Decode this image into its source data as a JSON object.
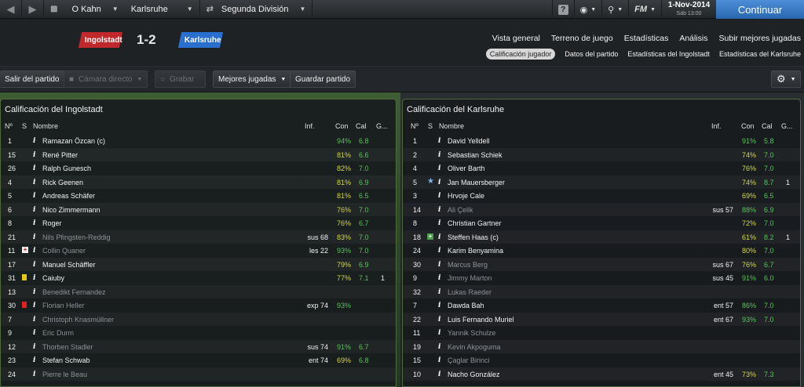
{
  "topbar": {
    "manager": "O Kahn",
    "club": "Karlsruhe",
    "competition": "Segunda División",
    "date": "1-Nov-2014",
    "time": "Sáb 13:00",
    "fm_label": "FM",
    "help_label": "?",
    "continue_label": "Continuar"
  },
  "match": {
    "home_team": "Ingolstadt",
    "away_team": "Karlsruhe",
    "score": "1-2",
    "home_color": "#c1282b",
    "away_color": "#2a6fd0"
  },
  "tabs_main": [
    "Vista general",
    "Terreno de juego",
    "Estadísticas",
    "Análisis",
    "Subir mejores jugadas"
  ],
  "tabs_sub": [
    {
      "label": "Calificación jugador",
      "active": true
    },
    {
      "label": "Datos del partido",
      "active": false
    },
    {
      "label": "Estadísticas del Ingolstadt",
      "active": false
    },
    {
      "label": "Estadísticas del Karlsruhe",
      "active": false
    }
  ],
  "toolbar": {
    "exit_label": "Salir del partido",
    "camera_label": "Cámara directo",
    "record_label": "Grabar",
    "highlights_label": "Mejores jugadas",
    "save_label": "Guardar partido"
  },
  "columns": {
    "num": "Nº",
    "status": "S",
    "name": "Nombre",
    "inf": "Inf.",
    "con": "Con",
    "cal": "Cal",
    "g": "G..."
  },
  "home_panel": {
    "title": "Calificación del Ingolstadt",
    "players": [
      {
        "num": "1",
        "status": "",
        "name": "Ramazan Özcan (c)",
        "inf": "",
        "con": "94%",
        "cal": "6.8",
        "g": "",
        "sub": false
      },
      {
        "num": "15",
        "status": "",
        "name": "René Pitter",
        "inf": "",
        "con": "81%",
        "cal": "6.6",
        "g": "",
        "sub": false
      },
      {
        "num": "26",
        "status": "",
        "name": "Ralph Gunesch",
        "inf": "",
        "con": "82%",
        "cal": "7.0",
        "g": "",
        "sub": false
      },
      {
        "num": "4",
        "status": "",
        "name": "Rick Geenen",
        "inf": "",
        "con": "81%",
        "cal": "6.9",
        "g": "",
        "sub": false
      },
      {
        "num": "5",
        "status": "",
        "name": "Andreas Schäfer",
        "inf": "",
        "con": "81%",
        "cal": "6.5",
        "g": "",
        "sub": false
      },
      {
        "num": "6",
        "status": "",
        "name": "Nico Zimmermann",
        "inf": "",
        "con": "76%",
        "cal": "7.0",
        "g": "",
        "sub": false
      },
      {
        "num": "8",
        "status": "",
        "name": "Roger",
        "inf": "",
        "con": "76%",
        "cal": "6.7",
        "g": "",
        "sub": false
      },
      {
        "num": "21",
        "status": "",
        "name": "Nils Pfingsten-Reddig",
        "inf": "sus 68",
        "con": "83%",
        "cal": "7.0",
        "g": "",
        "sub": true
      },
      {
        "num": "11",
        "status": "injury",
        "name": "Collin Quaner",
        "inf": "les 22",
        "con": "93%",
        "cal": "7.0",
        "g": "",
        "sub": true
      },
      {
        "num": "17",
        "status": "",
        "name": "Manuel Schäffler",
        "inf": "",
        "con": "79%",
        "cal": "6.9",
        "g": "",
        "sub": false
      },
      {
        "num": "31",
        "status": "yellow",
        "name": "Caiuby",
        "inf": "",
        "con": "77%",
        "cal": "7.1",
        "g": "1",
        "sub": false
      },
      {
        "num": "13",
        "status": "",
        "name": "Benedikt Fernandez",
        "inf": "",
        "con": "",
        "cal": "",
        "g": "",
        "sub": true
      },
      {
        "num": "30",
        "status": "red",
        "name": "Florian Heller",
        "inf": "exp 74",
        "con": "93%",
        "cal": "",
        "g": "",
        "sub": true
      },
      {
        "num": "7",
        "status": "",
        "name": "Christoph Knasmüllner",
        "inf": "",
        "con": "",
        "cal": "",
        "g": "",
        "sub": true
      },
      {
        "num": "9",
        "status": "",
        "name": "Eric Durm",
        "inf": "",
        "con": "",
        "cal": "",
        "g": "",
        "sub": true
      },
      {
        "num": "12",
        "status": "",
        "name": "Thorben Stadler",
        "inf": "sus 74",
        "con": "91%",
        "cal": "6.7",
        "g": "",
        "sub": true
      },
      {
        "num": "23",
        "status": "",
        "name": "Stefan Schwab",
        "inf": "ent 74",
        "con": "69%",
        "cal": "6.8",
        "g": "",
        "sub": false
      },
      {
        "num": "24",
        "status": "",
        "name": "Pierre le Beau",
        "inf": "",
        "con": "",
        "cal": "",
        "g": "",
        "sub": true
      }
    ]
  },
  "away_panel": {
    "title": "Calificación del Karlsruhe",
    "players": [
      {
        "num": "1",
        "status": "",
        "name": "David Yelldell",
        "inf": "",
        "con": "91%",
        "cal": "5.8",
        "g": "",
        "sub": false
      },
      {
        "num": "2",
        "status": "",
        "name": "Sebastian Schiek",
        "inf": "",
        "con": "74%",
        "cal": "7.0",
        "g": "",
        "sub": false
      },
      {
        "num": "4",
        "status": "",
        "name": "Oliver Barth",
        "inf": "",
        "con": "76%",
        "cal": "7.0",
        "g": "",
        "sub": false
      },
      {
        "num": "5",
        "status": "star",
        "name": "Jan Mauersberger",
        "inf": "",
        "con": "74%",
        "cal": "8.7",
        "g": "1",
        "sub": false
      },
      {
        "num": "3",
        "status": "",
        "name": "Hrvoje Cale",
        "inf": "",
        "con": "69%",
        "cal": "6.5",
        "g": "",
        "sub": false
      },
      {
        "num": "14",
        "status": "",
        "name": "Ali Çelik",
        "inf": "sus 57",
        "con": "88%",
        "cal": "6.9",
        "g": "",
        "sub": true
      },
      {
        "num": "8",
        "status": "",
        "name": "Christian Gartner",
        "inf": "",
        "con": "72%",
        "cal": "7.0",
        "g": "",
        "sub": false
      },
      {
        "num": "18",
        "status": "plus",
        "name": "Steffen Haas (c)",
        "inf": "",
        "con": "61%",
        "cal": "8.2",
        "g": "1",
        "sub": false
      },
      {
        "num": "24",
        "status": "",
        "name": "Karim Benyamina",
        "inf": "",
        "con": "80%",
        "cal": "7.0",
        "g": "",
        "sub": false
      },
      {
        "num": "30",
        "status": "",
        "name": "Marcus Berg",
        "inf": "sus 67",
        "con": "76%",
        "cal": "6.7",
        "g": "",
        "sub": true
      },
      {
        "num": "9",
        "status": "",
        "name": "Jimmy Marton",
        "inf": "sus 45",
        "con": "91%",
        "cal": "6.0",
        "g": "",
        "sub": true
      },
      {
        "num": "32",
        "status": "",
        "name": "Lukas Raeder",
        "inf": "",
        "con": "",
        "cal": "",
        "g": "",
        "sub": true
      },
      {
        "num": "7",
        "status": "",
        "name": "Dawda Bah",
        "inf": "ent 57",
        "con": "86%",
        "cal": "7.0",
        "g": "",
        "sub": false
      },
      {
        "num": "22",
        "status": "",
        "name": "Luis Fernando Muriel",
        "inf": "ent 67",
        "con": "93%",
        "cal": "7.0",
        "g": "",
        "sub": false
      },
      {
        "num": "11",
        "status": "",
        "name": "Yannik Schulze",
        "inf": "",
        "con": "",
        "cal": "",
        "g": "",
        "sub": true
      },
      {
        "num": "19",
        "status": "",
        "name": "Kevin Akpoguma",
        "inf": "",
        "con": "",
        "cal": "",
        "g": "",
        "sub": true
      },
      {
        "num": "15",
        "status": "",
        "name": "Çaglar Birinci",
        "inf": "",
        "con": "",
        "cal": "",
        "g": "",
        "sub": true
      },
      {
        "num": "10",
        "status": "",
        "name": "Nacho González",
        "inf": "ent 45",
        "con": "73%",
        "cal": "7.3",
        "g": "",
        "sub": false
      }
    ]
  }
}
